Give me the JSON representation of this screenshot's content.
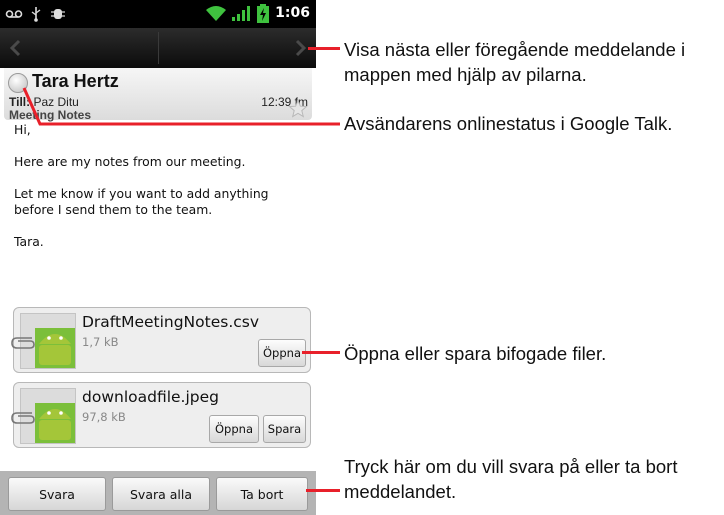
{
  "status_bar": {
    "time": "1:06",
    "icons": [
      "voicemail-icon",
      "usb-icon",
      "debug-icon",
      "wifi-icon",
      "signal-icon",
      "battery-charging-icon"
    ]
  },
  "nav": {
    "prev_icon": "chevron-left-icon",
    "next_icon": "chevron-right-icon"
  },
  "message": {
    "sender": "Tara Hertz",
    "to_label": "Till:",
    "to_value": "Paz Ditu",
    "time": "12:39 fm",
    "subject": "Meeting Notes",
    "starred": false,
    "body": [
      "Hi,",
      "Here are my notes from our meeting.",
      "Let me know if you want to add anything before I send them to the team.",
      "Tara."
    ]
  },
  "attachments": [
    {
      "name": "DraftMeetingNotes.csv",
      "size": "1,7 kB",
      "open_label": "Öppna"
    },
    {
      "name": "downloadfile.jpeg",
      "size": "97,8 kB",
      "open_label": "Öppna",
      "save_label": "Spara"
    }
  ],
  "actions": {
    "reply": "Svara",
    "reply_all": "Svara alla",
    "delete": "Ta bort"
  },
  "callouts": {
    "nav": "Visa nästa eller föregående meddelande i mappen med hjälp av pilarna.",
    "status": "Avsändarens onlinestatus i Google Talk.",
    "attachments": "Öppna eller spara bifogade filer.",
    "actions": "Tryck här om du vill svara på eller ta bort meddelandet."
  },
  "colors": {
    "callout_line": "#e8202a",
    "status_bar": "#000000",
    "android_green": "#a4c639"
  }
}
